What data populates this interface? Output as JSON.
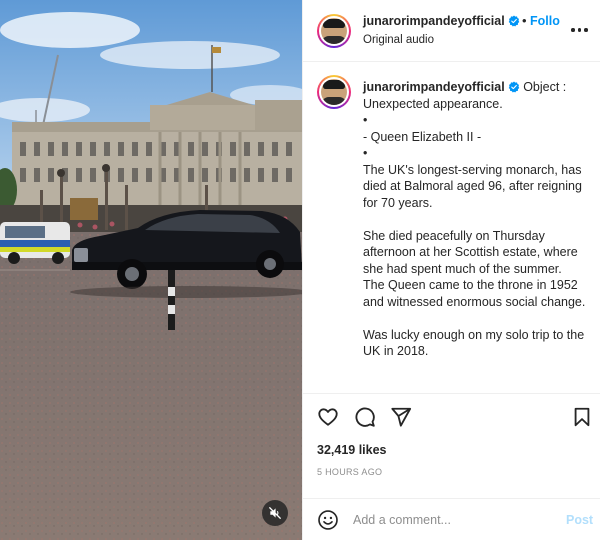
{
  "post": {
    "username": "junarorimpandeyofficial",
    "follow_separator": "•",
    "follow_label": "Follo",
    "audio_label": "Original audio",
    "caption_lines": [
      "Object :",
      "Unexpected appearance.",
      "•",
      "- Queen Elizabeth II -",
      "•",
      "The UK's longest-serving monarch, has died at Balmoral aged 96, after reigning for 70 years.",
      "",
      "She died peacefully on Thursday afternoon at her Scottish estate, where she had spent much of the summer.",
      "The Queen came to the throne in 1952 and witnessed enormous social change.",
      "",
      "Was lucky enough on my solo trip to the UK in 2018."
    ],
    "likes": "32,419 likes",
    "time_ago": "5 HOURS AGO"
  },
  "comment": {
    "placeholder": "Add a comment...",
    "post_label": "Post"
  },
  "icons": {
    "verified": "verified-badge-icon",
    "more": "more-options-icon",
    "like": "heart-icon",
    "comment": "comment-bubble-icon",
    "share": "paper-plane-icon",
    "save": "bookmark-icon",
    "emoji": "emoji-smiley-icon",
    "mute": "speaker-muted-icon"
  },
  "colors": {
    "follow_blue": "#0095f6",
    "post_disabled": "#b2dffc",
    "verified_blue": "#0095f6",
    "muted_text": "#8e8e8e"
  }
}
